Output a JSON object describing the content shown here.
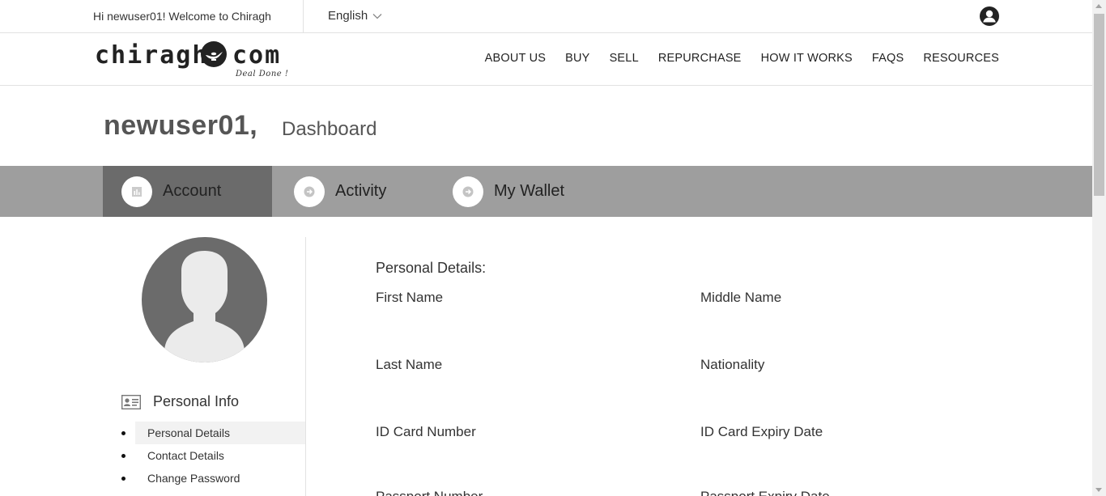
{
  "topbar": {
    "welcome": "Hi newuser01! Welcome to Chiragh",
    "language": "English",
    "language_icon": "chevron-down-icon",
    "account_icon": "user-circle-icon"
  },
  "logo": {
    "word_left": "chiragh",
    "word_right": "com",
    "tagline": "Deal Done !"
  },
  "nav": {
    "items": [
      "ABOUT US",
      "BUY",
      "SELL",
      "REPURCHASE",
      "HOW IT WORKS",
      "FAQS",
      "RESOURCES"
    ]
  },
  "page": {
    "username": "newuser01,",
    "title": "Dashboard"
  },
  "tabs": [
    {
      "label": "Account",
      "icon": "chart-icon",
      "active": true
    },
    {
      "label": "Activity",
      "icon": "arrow-right-circle-icon",
      "active": false
    },
    {
      "label": "My Wallet",
      "icon": "arrow-right-circle-icon",
      "active": false
    }
  ],
  "sidebar": {
    "avatar_icon": "avatar-placeholder-icon",
    "section_label": "Personal Info",
    "section_icon": "id-card-icon",
    "items": [
      "Personal Details",
      "Contact Details",
      "Change Password"
    ],
    "active_item": "Personal Details"
  },
  "content": {
    "section_title": "Personal Details:",
    "fields_left": [
      "First Name",
      "Last Name",
      "ID Card Number",
      "Passport Number"
    ],
    "fields_right": [
      "Middle Name",
      "Nationality",
      "ID Card Expiry Date",
      "Passport Expiry Date"
    ]
  },
  "colors": {
    "tabbar": "#9e9e9e",
    "tab_active": "#6b6b6b",
    "avatar": "#6b6b6b"
  }
}
